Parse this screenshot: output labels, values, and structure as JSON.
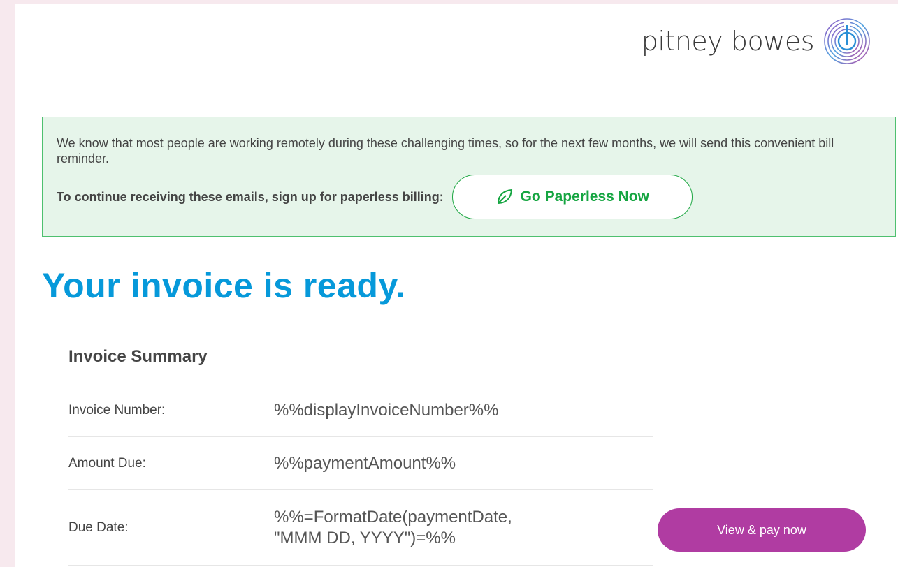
{
  "brand": {
    "name": "pitney bowes",
    "logo_icon": "pitney-bowes-logo-icon"
  },
  "notice": {
    "message": "We know that most people are working remotely during these challenging times, so for the next few months, we will send this convenient bill reminder.",
    "cta_text": "To continue receiving these emails, sign up for paperless billing:",
    "button_label": "Go Paperless Now",
    "button_icon": "leaf-icon"
  },
  "headline": "Your invoice is ready.",
  "summary": {
    "title": "Invoice Summary",
    "rows": [
      {
        "label": "Invoice Number:",
        "value": "%%displayInvoiceNumber%%"
      },
      {
        "label": "Amount Due:",
        "value": "%%paymentAmount%%"
      },
      {
        "label": "Due Date:",
        "value": "%%=FormatDate(paymentDate, \"MMM DD, YYYY\")=%%"
      }
    ]
  },
  "pay_button": "View & pay now",
  "colors": {
    "accent_blue": "#0699da",
    "accent_green": "#15a541",
    "accent_purple": "#b03ca2",
    "notice_bg": "#e6f5ea"
  }
}
